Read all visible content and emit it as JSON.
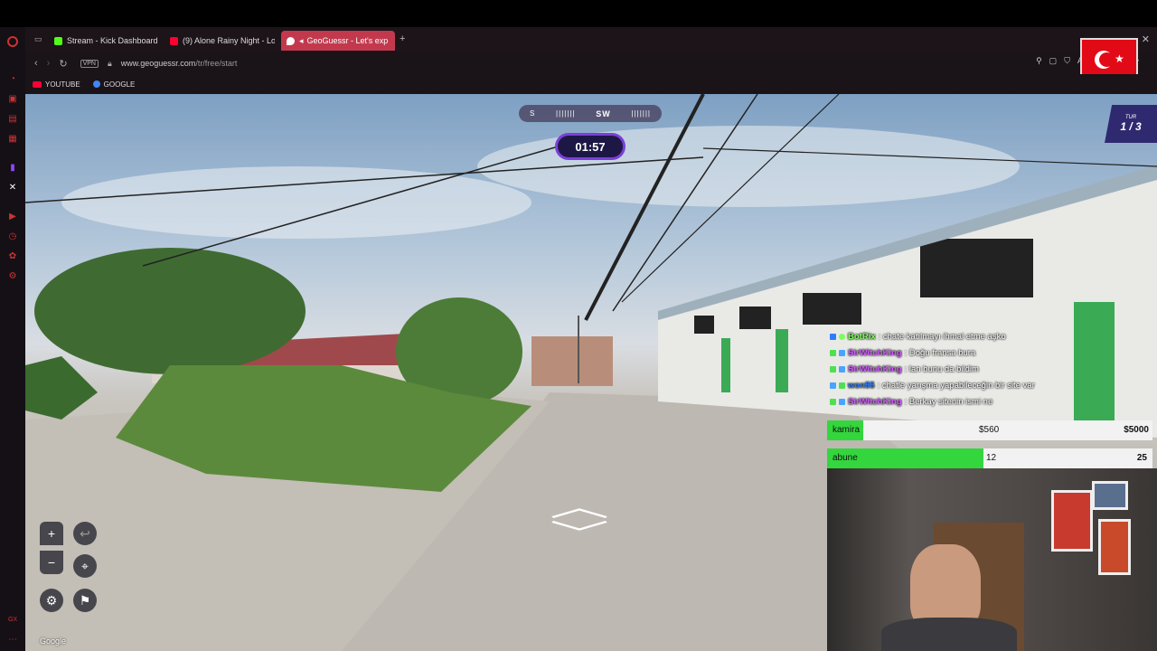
{
  "tabs": [
    {
      "label": "Stream - Kick Dashboard",
      "favcolor": "#53fc18"
    },
    {
      "label": "(9) Alone Rainy Night - Lo",
      "favcolor": "#ff0033"
    },
    {
      "label": "GeoGuessr - Let's exp",
      "favcolor": "#ffffff"
    }
  ],
  "address": {
    "vpn": "VPN",
    "url_host": "www.geoguessr.com",
    "url_path": "/tr/free/start"
  },
  "bookmarks": [
    {
      "label": "YOUTUBE",
      "color": "#ff0033"
    },
    {
      "label": "GOOGLE",
      "color": "#4285f4"
    }
  ],
  "game": {
    "compass_left": "S",
    "compass_dir": "SW",
    "timer": "01:57",
    "round_label": "TUR",
    "round_value": "1 / 3",
    "google_label": "Google"
  },
  "chat": [
    {
      "user": "BotRix",
      "text": ": chate katılmayı ihmal etme aşko",
      "color": "#7cff5b"
    },
    {
      "user": "SirWitchKing",
      "text": ": Doğu fransa bura",
      "color": "#d25cff"
    },
    {
      "user": "SirWitchKing",
      "text": ": lan bunu da bildim",
      "color": "#d25cff"
    },
    {
      "user": "won55",
      "text": ": chatle yarışma yapabileceğin bir site var",
      "color": "#2f7dff"
    },
    {
      "user": "SirWitchKing",
      "text": ": Berkay sitenin ismi ne",
      "color": "#d25cff"
    }
  ],
  "goals": [
    {
      "label": "kamira",
      "mid": "$560",
      "end": "$5000",
      "fraction": 0.112
    },
    {
      "label": "abune",
      "mid": "12",
      "end": "25",
      "fraction": 0.48
    }
  ],
  "icons": {
    "opera": "opera-icon",
    "reload": "reload-icon",
    "lock": "lock-icon"
  },
  "colors": {
    "accent": "#c2394e",
    "timer_border": "#7b3fd9",
    "goal_fill": "#33d63d"
  }
}
